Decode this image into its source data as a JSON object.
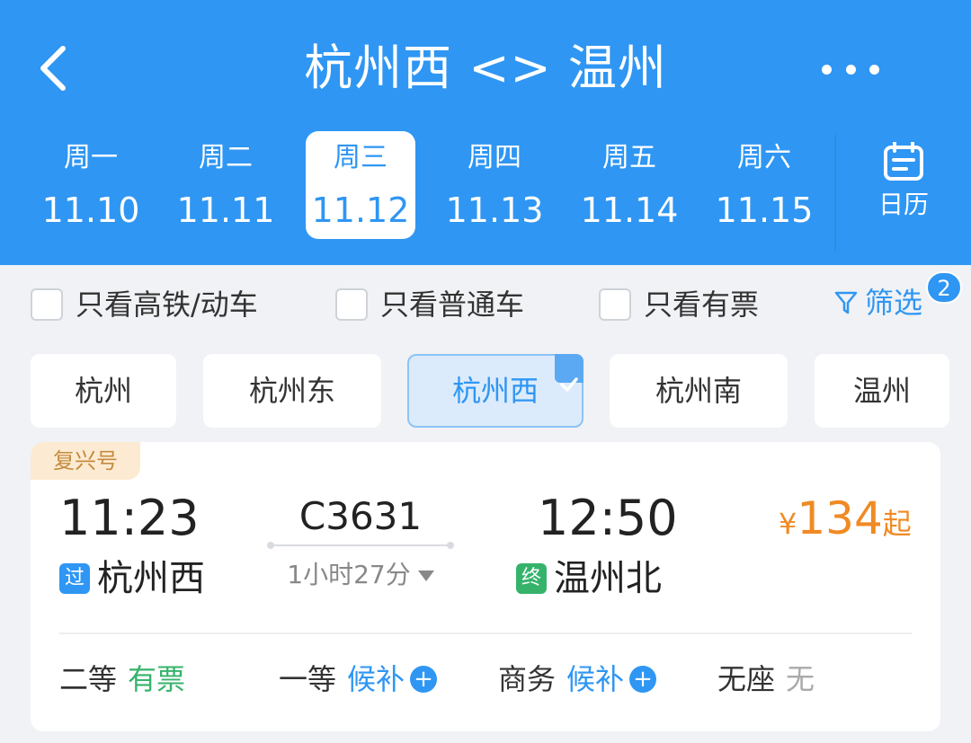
{
  "header": {
    "title": "杭州西 <> 温州",
    "more_icon": "more-icon",
    "back_icon": "chevron-left-icon"
  },
  "dates": [
    {
      "weekday": "周一",
      "date": "11.10",
      "active": false
    },
    {
      "weekday": "周二",
      "date": "11.11",
      "active": false
    },
    {
      "weekday": "周三",
      "date": "11.12",
      "active": true
    },
    {
      "weekday": "周四",
      "date": "11.13",
      "active": false
    },
    {
      "weekday": "周五",
      "date": "11.14",
      "active": false
    },
    {
      "weekday": "周六",
      "date": "11.15",
      "active": false
    }
  ],
  "calendar": {
    "label": "日历",
    "icon": "calendar-icon"
  },
  "filters": {
    "high_speed": "只看高铁/动车",
    "normal": "只看普通车",
    "available": "只看有票",
    "screen_label": "筛选",
    "screen_badge": "2"
  },
  "stations": [
    {
      "name": "杭州",
      "active": false
    },
    {
      "name": "杭州东",
      "active": false
    },
    {
      "name": "杭州西",
      "active": true
    },
    {
      "name": "杭州南",
      "active": false
    },
    {
      "name": "温州",
      "active": false
    }
  ],
  "train": {
    "tag": "复兴号",
    "dep_time": "11:23",
    "arr_time": "12:50",
    "train_no": "C3631",
    "duration": "1小时27分",
    "dep_station_icon": "过",
    "dep_station": "杭州西",
    "arr_station_icon": "终",
    "arr_station": "温州北",
    "price_currency": "¥",
    "price": "134",
    "price_suffix": "起",
    "seats": [
      {
        "class": "二等",
        "status": "有票",
        "kind": "ok"
      },
      {
        "class": "一等",
        "status": "候补",
        "kind": "wait"
      },
      {
        "class": "商务",
        "status": "候补",
        "kind": "wait"
      },
      {
        "class": "无座",
        "status": "无",
        "kind": "none"
      }
    ]
  },
  "colors": {
    "brand": "#2f96f3",
    "price": "#f08a24",
    "available": "#35b36b"
  }
}
